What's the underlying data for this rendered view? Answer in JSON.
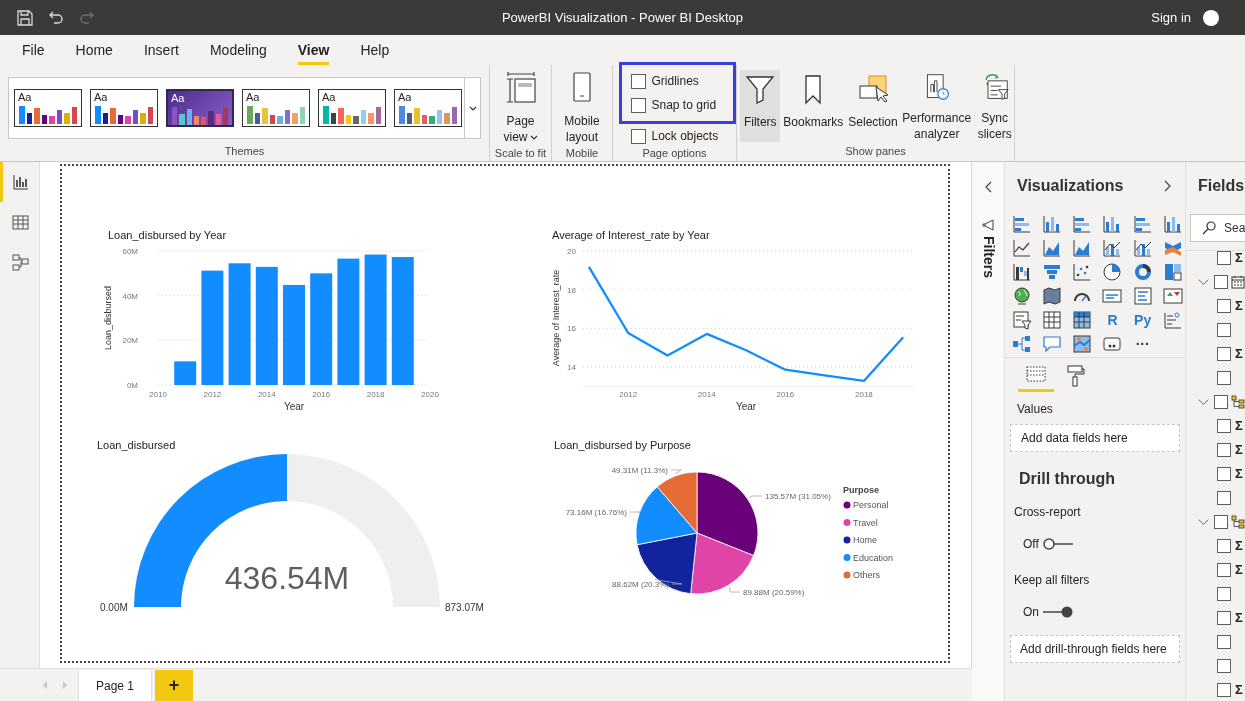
{
  "title_bar": {
    "title": "PowerBI Visualization - Power BI Desktop",
    "sign_in": "Sign in",
    "undo": {
      "disabled": false
    },
    "redo": {
      "disabled": true
    }
  },
  "menu_tabs": [
    {
      "label": "File",
      "selected": false
    },
    {
      "label": "Home",
      "selected": false
    },
    {
      "label": "Insert",
      "selected": false
    },
    {
      "label": "Modeling",
      "selected": false
    },
    {
      "label": "View",
      "selected": true
    },
    {
      "label": "Help",
      "selected": false
    }
  ],
  "ribbon": {
    "themes": {
      "group": "Themes",
      "items": [
        {
          "label": "Aa",
          "selected": false,
          "kind": "light"
        },
        {
          "label": "Aa",
          "selected": false,
          "kind": "light"
        },
        {
          "label": "Aa",
          "selected": true,
          "kind": "dark"
        },
        {
          "label": "Aa",
          "selected": false,
          "kind": "light"
        },
        {
          "label": "Aa",
          "selected": false,
          "kind": "light"
        },
        {
          "label": "Aa",
          "selected": false,
          "kind": "light"
        }
      ]
    },
    "page_view": {
      "label": "Page view",
      "group": "Scale to fit"
    },
    "mobile_layout": {
      "label": "Mobile layout",
      "group": "Mobile"
    },
    "page_options": {
      "group": "Page options",
      "options": [
        {
          "label": "Gridlines",
          "checked": false,
          "highlighted": true
        },
        {
          "label": "Snap to grid",
          "checked": false,
          "highlighted": true
        },
        {
          "label": "Lock objects",
          "checked": false,
          "highlighted": false
        }
      ]
    },
    "show_panes": {
      "group": "Show panes",
      "buttons": [
        {
          "kind": "filters",
          "label": "Filters",
          "selected": true
        },
        {
          "kind": "bookmarks",
          "label": "Bookmarks",
          "selected": false
        },
        {
          "kind": "selection",
          "label": "Selection",
          "selected": false
        },
        {
          "kind": "performance",
          "label": "Performance analyzer",
          "selected": false
        },
        {
          "kind": "sync",
          "label": "Sync slicers",
          "selected": false
        }
      ]
    }
  },
  "left_rail": [
    {
      "kind": "report",
      "selected": true
    },
    {
      "kind": "data",
      "selected": false
    },
    {
      "kind": "model",
      "selected": false
    }
  ],
  "report": {
    "visuals": [
      {
        "chart_data": {
          "type": "bar",
          "title": "Loan_disbursed by Year",
          "xlabel": "Year",
          "ylabel": "Loan_disbursed",
          "x": [
            2011,
            2012,
            2013,
            2014,
            2015,
            2016,
            2017,
            2018,
            2019
          ],
          "series": [
            {
              "color": "#118dff",
              "values": [
                10.6,
                51.2,
                54.5,
                52.9,
                44.8,
                50.0,
                56.6,
                58.4,
                57.3
              ]
            }
          ],
          "xlim": [
            2010,
            2020
          ],
          "ylim": [
            0,
            60
          ],
          "grid": true,
          "xticks": [
            2010,
            2012,
            2014,
            2016,
            2018,
            2020
          ],
          "yticks": [
            {
              "value": 0,
              "label": "0M"
            },
            {
              "value": 20,
              "label": "20M"
            },
            {
              "value": 40,
              "label": "40M"
            },
            {
              "value": 60,
              "label": "60M"
            }
          ]
        }
      },
      {
        "chart_data": {
          "type": "line",
          "title": "Average of Interest_rate by Year",
          "xlabel": "Year",
          "ylabel": "Average of Interest_rate",
          "x": [
            2011,
            2012,
            2013,
            2014,
            2015,
            2016,
            2017,
            2018,
            2019
          ],
          "series": [
            {
              "color": "#118dff",
              "values": [
                19.18,
                15.76,
                14.6,
                15.71,
                14.86,
                13.86,
                13.57,
                13.28,
                15.54
              ]
            }
          ],
          "xlim": [
            2010.85,
            2019.3
          ],
          "ylim": [
            13,
            20
          ],
          "grid": true,
          "xticks": [
            2012,
            2014,
            2016,
            2018
          ],
          "yticks": [
            14,
            16,
            18,
            20
          ]
        }
      },
      {
        "kind": "gauge",
        "title": "Loan_disbursed",
        "value": "436.54M",
        "min": "0.00M",
        "max": "873.07M",
        "level": 0.5
      },
      {
        "chart_data": {
          "type": "pie",
          "title": "Loan_disbursed by Purpose",
          "categories": [
            "Personal",
            "Travel",
            "Home",
            "Education",
            "Others"
          ],
          "values": [
            31.05,
            20.59,
            20.3,
            16.76,
            11.3
          ],
          "value_labels": [
            "135.57M (31.05%)",
            "89.88M (20.59%)",
            "88.62M (20.3%)",
            "73.16M (16.76%)",
            "49.31M (11.3%)"
          ],
          "colors": [
            "#6b007b",
            "#e044a7",
            "#12239e",
            "#118dff",
            "#e66c37"
          ],
          "legend": {
            "title": "Purpose"
          }
        }
      }
    ]
  },
  "filters_pane": {
    "label": "Filters"
  },
  "visualizations": {
    "title": "Visualizations",
    "gallery": [
      {
        "kind": "hbar"
      },
      {
        "kind": "vbar"
      },
      {
        "kind": "hbar"
      },
      {
        "kind": "vbar"
      },
      {
        "kind": "hbar"
      },
      {
        "kind": "vbar"
      },
      {
        "kind": "line"
      },
      {
        "kind": "area"
      },
      {
        "kind": "area"
      },
      {
        "kind": "combo"
      },
      {
        "kind": "combo"
      },
      {
        "kind": "ribbon"
      },
      {
        "kind": "waterfall"
      },
      {
        "kind": "funnel"
      },
      {
        "kind": "scatter"
      },
      {
        "kind": "pie"
      },
      {
        "kind": "donut"
      },
      {
        "kind": "treemap"
      },
      {
        "kind": "globe"
      },
      {
        "kind": "shape_map"
      },
      {
        "kind": "gauge"
      },
      {
        "kind": "card"
      },
      {
        "kind": "multirow"
      },
      {
        "kind": "kpi"
      },
      {
        "kind": "slicer"
      },
      {
        "kind": "table"
      },
      {
        "kind": "matrix"
      },
      {
        "kind": "text",
        "label": "R"
      },
      {
        "kind": "text",
        "label": "Py"
      },
      {
        "kind": "influencers"
      },
      {
        "kind": "decomposition"
      },
      {
        "kind": "qa"
      },
      {
        "kind": "arcgis"
      },
      {
        "kind": "narrative"
      },
      {
        "kind": "more",
        "label": "···"
      }
    ],
    "tabs": [
      {
        "kind": "fields",
        "selected": true
      },
      {
        "kind": "format",
        "selected": false
      }
    ],
    "values_label": "Values",
    "values_well": "Add data fields here",
    "drill_title": "Drill through",
    "toggles": [
      {
        "label": "Cross-report",
        "state": "Off",
        "on": false
      },
      {
        "label": "Keep all filters",
        "state": "On",
        "on": true
      }
    ],
    "drill_well": "Add drill-through fields here"
  },
  "fields": {
    "title": "Fields",
    "search": {
      "placeholder": "Sea"
    },
    "tree": [
      {
        "kind": "measure",
        "symbol": "Σ",
        "checked": false
      },
      {
        "kind": "date_table",
        "expanded": true,
        "checked": false,
        "children": [
          {
            "kind": "measure",
            "symbol": "Σ",
            "checked": false
          },
          {
            "kind": "field",
            "checked": false
          },
          {
            "kind": "measure",
            "symbol": "Σ",
            "checked": false
          },
          {
            "kind": "field",
            "checked": false
          }
        ]
      },
      {
        "kind": "hierarchy_table",
        "expanded": true,
        "checked": false,
        "children": [
          {
            "kind": "measure",
            "symbol": "Σ",
            "checked": false
          },
          {
            "kind": "measure",
            "symbol": "Σ",
            "checked": false
          },
          {
            "kind": "measure",
            "symbol": "Σ",
            "checked": false
          },
          {
            "kind": "field",
            "checked": false
          }
        ]
      },
      {
        "kind": "hierarchy_table",
        "expanded": true,
        "checked": false,
        "children": [
          {
            "kind": "measure",
            "symbol": "Σ",
            "checked": false
          },
          {
            "kind": "measure",
            "symbol": "Σ",
            "checked": false
          },
          {
            "kind": "field",
            "checked": false
          },
          {
            "kind": "measure",
            "symbol": "Σ",
            "checked": false
          },
          {
            "kind": "field",
            "checked": false
          },
          {
            "kind": "field",
            "checked": false
          },
          {
            "kind": "measure",
            "symbol": "Σ",
            "checked": false
          }
        ]
      }
    ]
  },
  "page_tabs": [
    {
      "label": "Page 1",
      "selected": true
    }
  ],
  "add_page": "+"
}
